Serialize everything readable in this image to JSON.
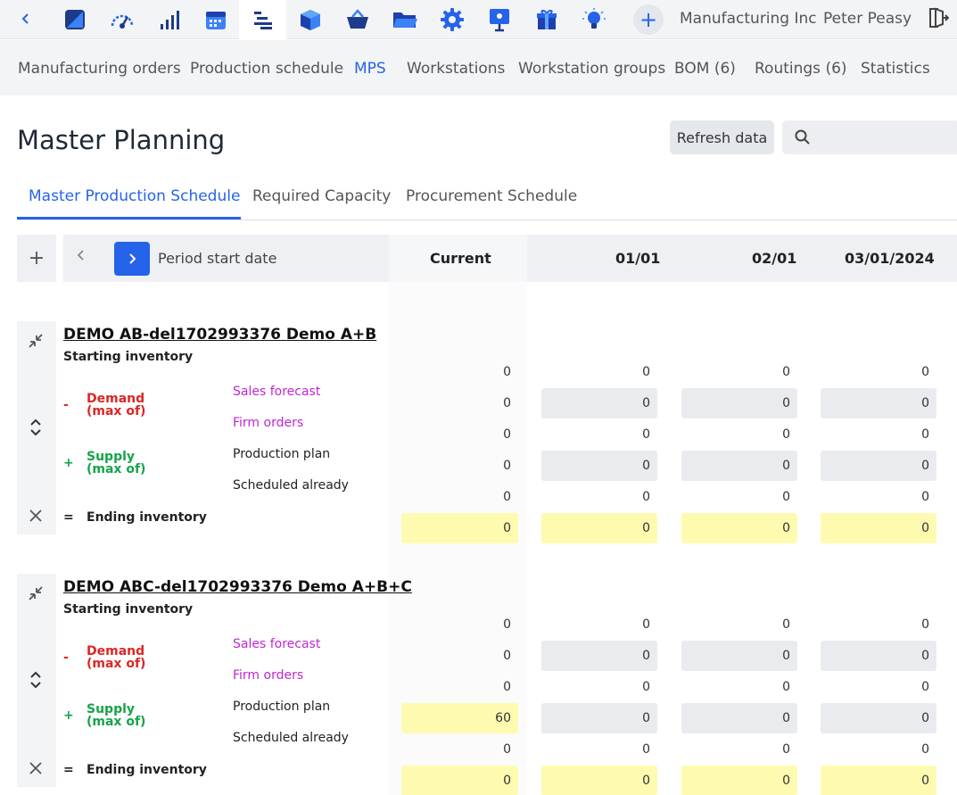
{
  "topbar": {
    "company": "Manufacturing Inc",
    "user": "Peter Peasy",
    "apps": [
      {
        "icon": "dashboard-icon",
        "color": "#1e3a8a"
      },
      {
        "icon": "gauge-icon",
        "color": "#2563eb"
      },
      {
        "icon": "bar-signal-icon",
        "color": "#1e3a8a"
      },
      {
        "icon": "calendar-icon",
        "color": "#2563eb"
      },
      {
        "icon": "production-lines-icon",
        "color": "#1e3a8a"
      },
      {
        "icon": "cube-icon",
        "color": "#1e40af"
      },
      {
        "icon": "basket-icon",
        "color": "#1e3a8a"
      },
      {
        "icon": "folder-icon",
        "color": "#2563eb"
      },
      {
        "icon": "gear-icon",
        "color": "#2563eb"
      },
      {
        "icon": "presentation-icon",
        "color": "#2563eb"
      },
      {
        "icon": "gift-icon",
        "color": "#1e40af"
      },
      {
        "icon": "lightbulb-icon",
        "color": "#2563eb"
      }
    ]
  },
  "subnav": [
    {
      "label": "Manufacturing orders",
      "active": false
    },
    {
      "label": "Production schedule",
      "active": false
    },
    {
      "label": "MPS",
      "active": true
    },
    {
      "label": "Workstations",
      "active": false
    },
    {
      "label": "Workstation groups",
      "active": false
    },
    {
      "label": "BOM (6)",
      "active": false
    },
    {
      "label": "Routings (6)",
      "active": false
    },
    {
      "label": "Statistics",
      "active": false
    }
  ],
  "page": {
    "title": "Master Planning",
    "refresh_label": "Refresh data",
    "search_value": ""
  },
  "tabs": [
    {
      "label": "Master Production Schedule",
      "active": true
    },
    {
      "label": "Required Capacity",
      "active": false
    },
    {
      "label": "Procurement Schedule",
      "active": false
    }
  ],
  "grid": {
    "period_label": "Period start date",
    "columns": [
      "Current",
      "01/01",
      "02/01",
      "03/01/2024"
    ],
    "labels": {
      "starting": "Starting inventory",
      "demand": "Demand\n(max of)",
      "supply": "Supply\n(max of)",
      "sales_forecast": "Sales forecast",
      "firm_orders": "Firm orders",
      "production_plan": "Production plan",
      "scheduled_already": "Scheduled already",
      "ending": "Ending inventory",
      "minus": "-",
      "plus": "+",
      "equals": "="
    }
  },
  "products": [
    {
      "title": "DEMO AB-del1702993376 Demo A+B",
      "starting": [
        "0",
        "0",
        "0",
        "0"
      ],
      "sales_forecast": [
        "0",
        "0",
        "0",
        "0"
      ],
      "firm_orders": [
        "0",
        "0",
        "0",
        "0"
      ],
      "production_plan": [
        "0",
        "0",
        "0",
        "0"
      ],
      "scheduled_already": [
        "0",
        "0",
        "0",
        "0"
      ],
      "ending": [
        "0",
        "0",
        "0",
        "0"
      ]
    },
    {
      "title": "DEMO ABC-del1702993376 Demo A+B+C",
      "starting": [
        "0",
        "0",
        "0",
        "0"
      ],
      "sales_forecast": [
        "0",
        "0",
        "0",
        "0"
      ],
      "firm_orders": [
        "0",
        "0",
        "0",
        "0"
      ],
      "production_plan": [
        "60",
        "0",
        "0",
        "0"
      ],
      "scheduled_already": [
        "0",
        "0",
        "0",
        "0"
      ],
      "ending": [
        "0",
        "0",
        "0",
        "0"
      ]
    }
  ]
}
